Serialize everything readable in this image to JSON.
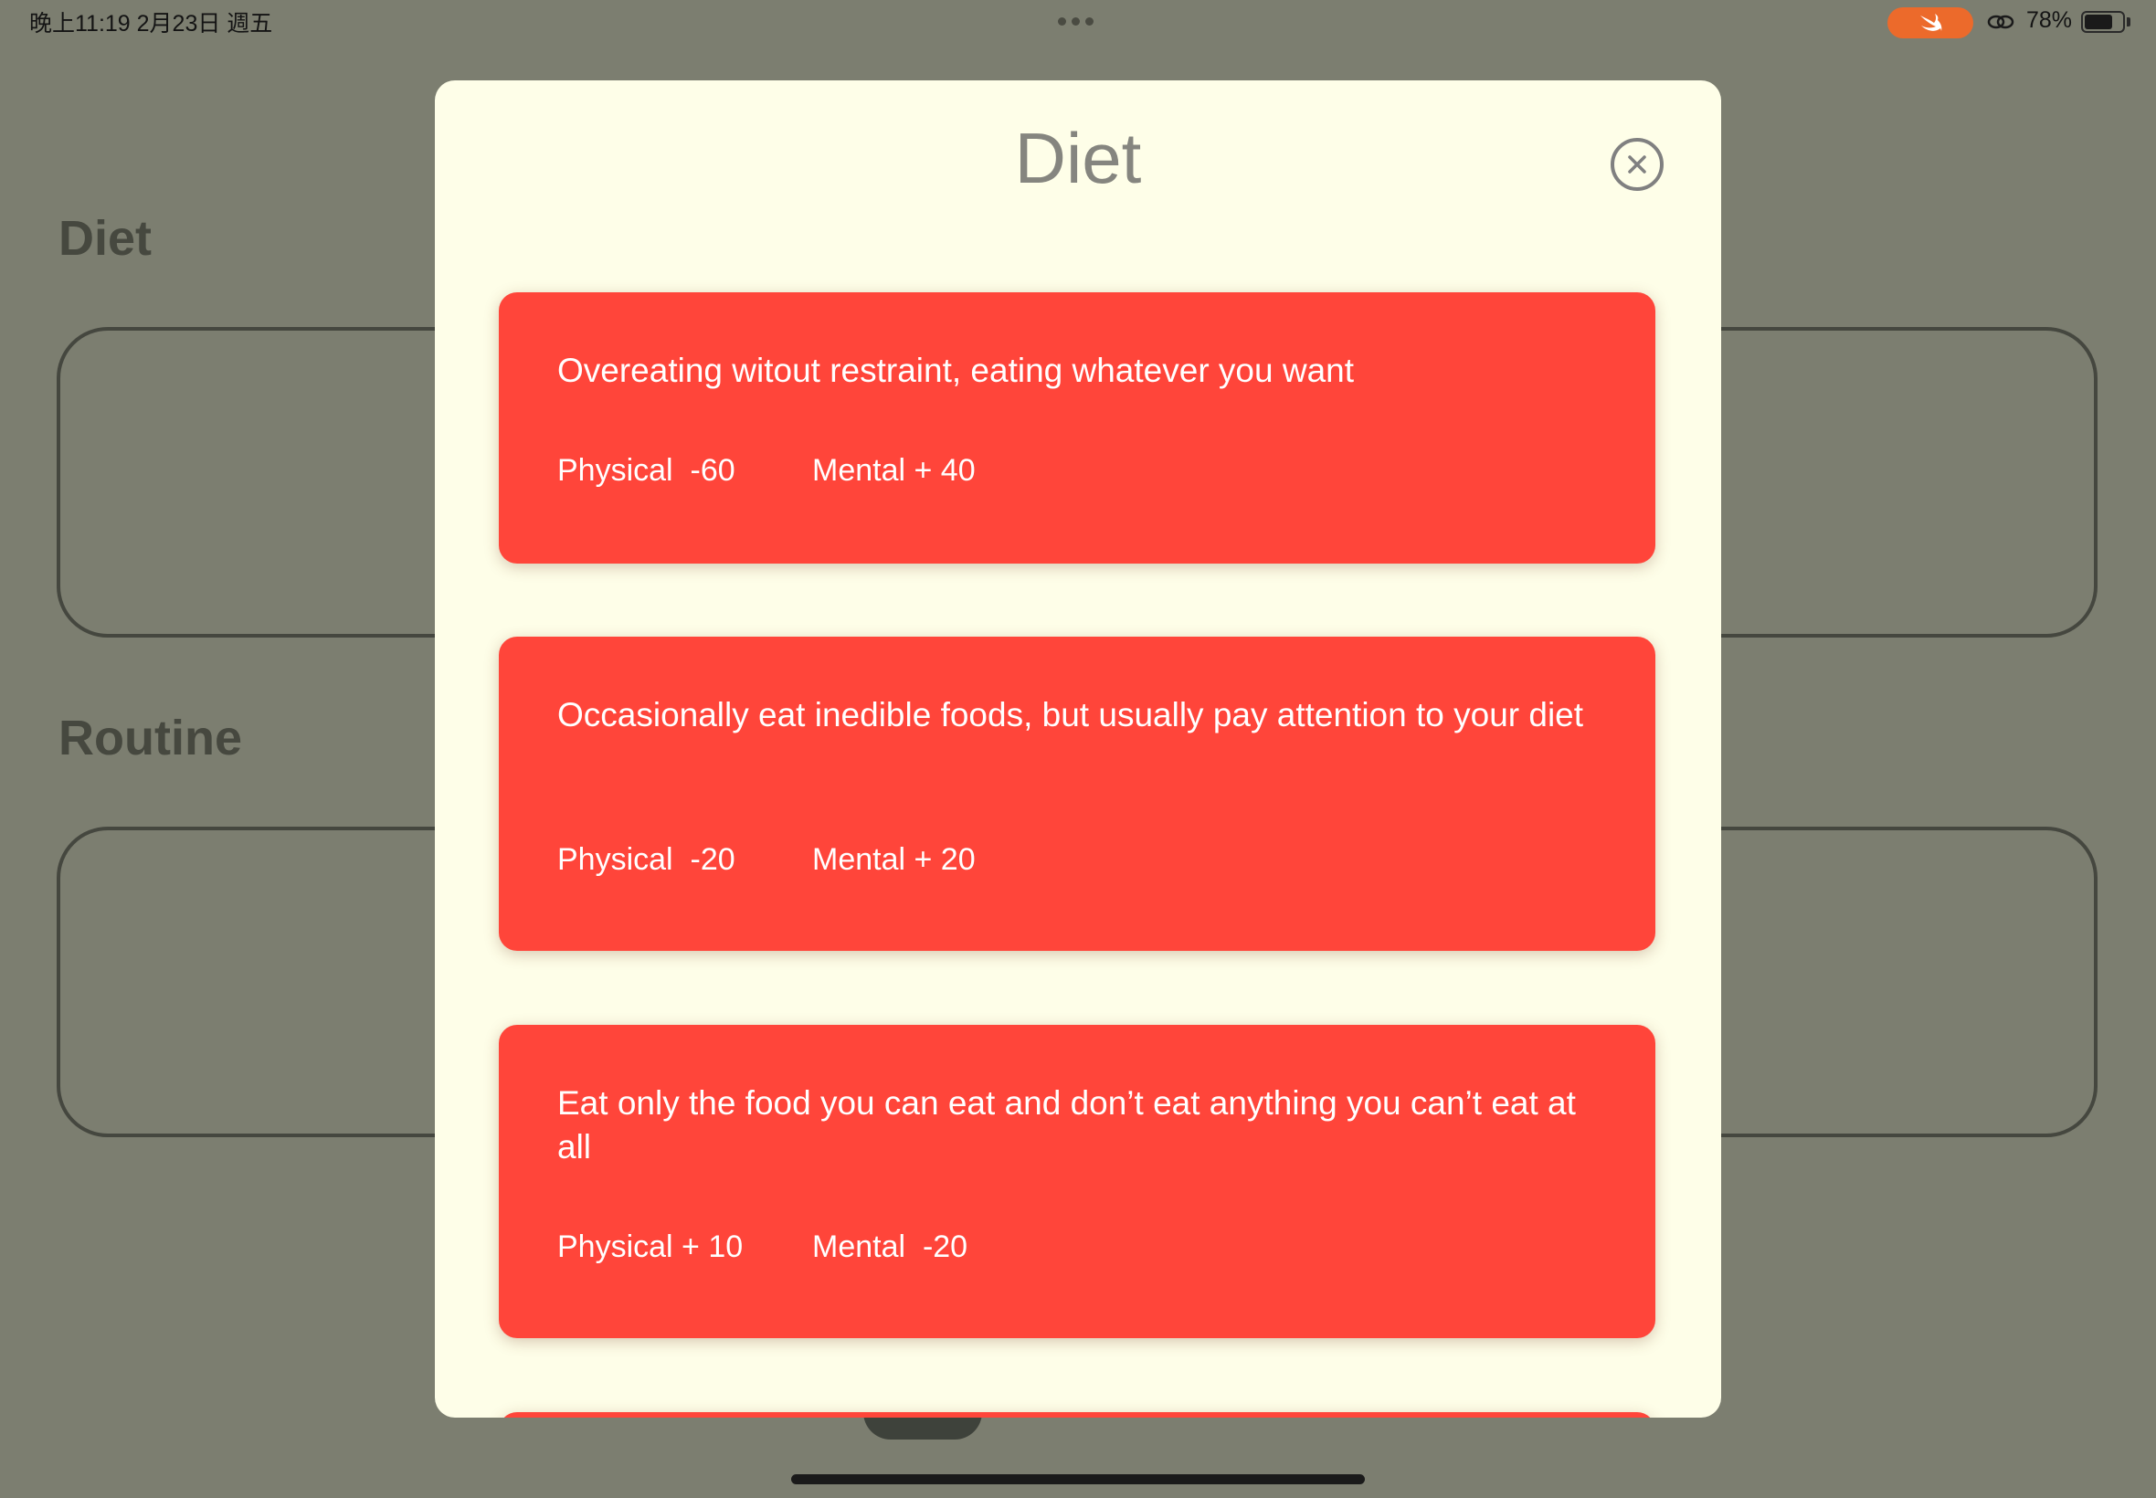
{
  "status_bar": {
    "time": "晚上11:19   2月23日 週五",
    "battery": "78%",
    "icons": [
      "ellipsis-icon",
      "swift-icon",
      "link-icon",
      "battery-icon"
    ]
  },
  "background": {
    "sections": [
      {
        "title": "Diet"
      },
      {
        "title": "Routine"
      }
    ]
  },
  "modal": {
    "title": "Diet",
    "close_icon": "circled-x-icon",
    "card_color": "#ff453a",
    "options": [
      {
        "description": "Overeating witout restraint, eating whatever you want",
        "physical": "Physical  -60",
        "mental": "Mental + 40"
      },
      {
        "description": "Occasionally eat inedible foods, but usually pay attention to your diet",
        "physical": "Physical  -20",
        "mental": "Mental + 20"
      },
      {
        "description": "Eat only the food you can eat and don’t eat anything you can’t eat at all",
        "physical": "Physical + 10",
        "mental": "Mental  -20"
      }
    ]
  }
}
